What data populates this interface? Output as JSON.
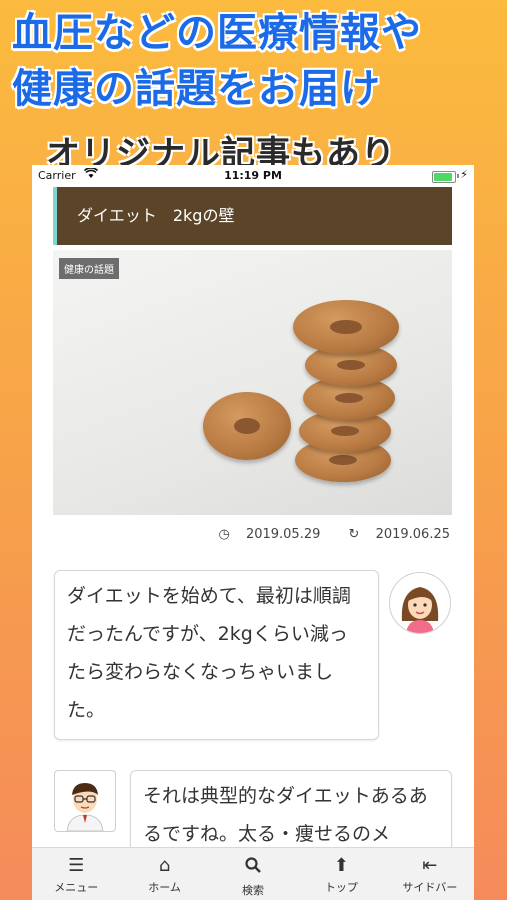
{
  "promo": {
    "line1": "血圧などの医療情報や",
    "line2": "健康の話題をお届け",
    "line3": "オリジナル記事もあり"
  },
  "status_bar": {
    "carrier": "Carrier",
    "time": "11:19 PM",
    "battery_level": 0.9
  },
  "article": {
    "title": "ダイエット　2kgの壁",
    "category": "健康の話題",
    "published": "2019.05.29",
    "updated": "2019.06.25"
  },
  "conversation": [
    {
      "speaker": "woman",
      "text": "ダイエットを始めて、最初は順調だったんですが、2kgくらい減ったら変わらなくなっちゃいました。"
    },
    {
      "speaker": "doctor",
      "text": "それは典型的なダイエットあるあるですね。太る・痩せるのメ"
    }
  ],
  "tabbar": {
    "items": [
      {
        "label": "メニュー",
        "icon": "menu-icon"
      },
      {
        "label": "ホーム",
        "icon": "home-icon"
      },
      {
        "label": "検索",
        "icon": "search-icon"
      },
      {
        "label": "トップ",
        "icon": "arrow-up-icon"
      },
      {
        "label": "サイドバー",
        "icon": "sidebar-icon"
      }
    ]
  },
  "colors": {
    "promo_text": "#1b6ae8",
    "header_bg": "#5b4427",
    "header_accent": "#7fd6d0",
    "background_top": "#fbbb3e",
    "background_bottom": "#f58b5b"
  }
}
